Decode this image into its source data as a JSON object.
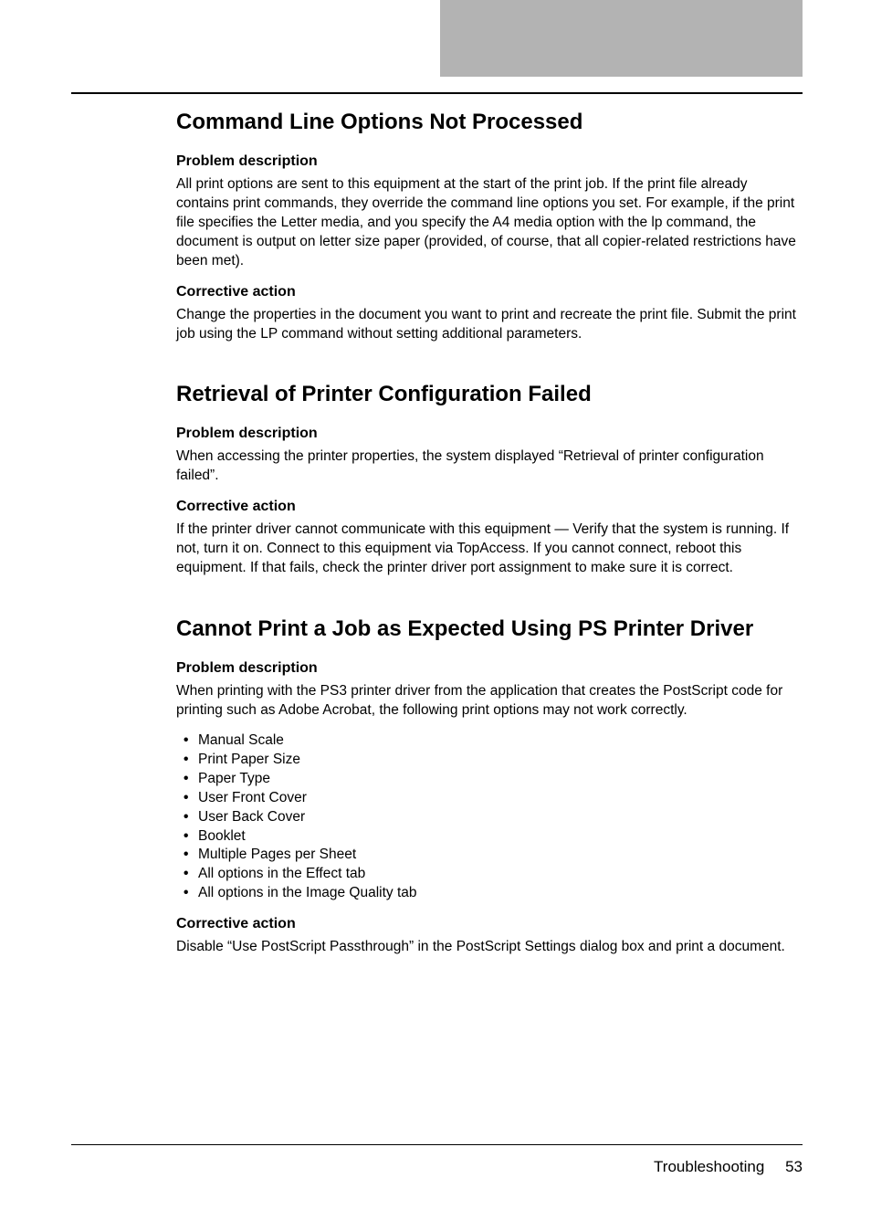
{
  "sections": [
    {
      "title": "Command Line Options Not Processed",
      "problem_heading": "Problem description",
      "problem_text": "All print options are sent to this equipment at the start of the print job. If the print file already contains print commands, they override the command line options you set. For example, if the print file specifies the Letter media, and you specify the A4 media option with the lp command, the document is output on letter size paper (provided, of course, that all copier-related restrictions have been met).",
      "action_heading": "Corrective action",
      "action_text": "Change the properties in the document you want to print and recreate the print file. Submit the print job using the LP command without setting additional parameters."
    },
    {
      "title": "Retrieval of Printer Configuration Failed",
      "problem_heading": "Problem description",
      "problem_text": "When accessing the printer properties, the system displayed “Retrieval of printer configuration failed”.",
      "action_heading": "Corrective action",
      "action_text": "If the printer driver cannot communicate with this equipment — Verify that the system is running. If not, turn it on. Connect to this equipment via TopAccess. If you cannot connect, reboot this equipment. If that fails, check the printer driver port assignment to make sure it is correct."
    },
    {
      "title": "Cannot Print a Job as Expected Using PS Printer Driver",
      "problem_heading": "Problem description",
      "problem_text": "When printing with the PS3 printer driver from the application that creates the PostScript code for printing such as Adobe Acrobat, the following print options may not work correctly.",
      "list": [
        "Manual Scale",
        "Print Paper Size",
        "Paper Type",
        "User Front Cover",
        "User Back Cover",
        "Booklet",
        "Multiple Pages per Sheet",
        "All options in the Effect tab",
        "All options in the Image Quality tab"
      ],
      "action_heading": "Corrective action",
      "action_text": "Disable “Use PostScript Passthrough” in the PostScript Settings dialog box and print a document."
    }
  ],
  "footer": {
    "label": "Troubleshooting",
    "page": "53"
  }
}
